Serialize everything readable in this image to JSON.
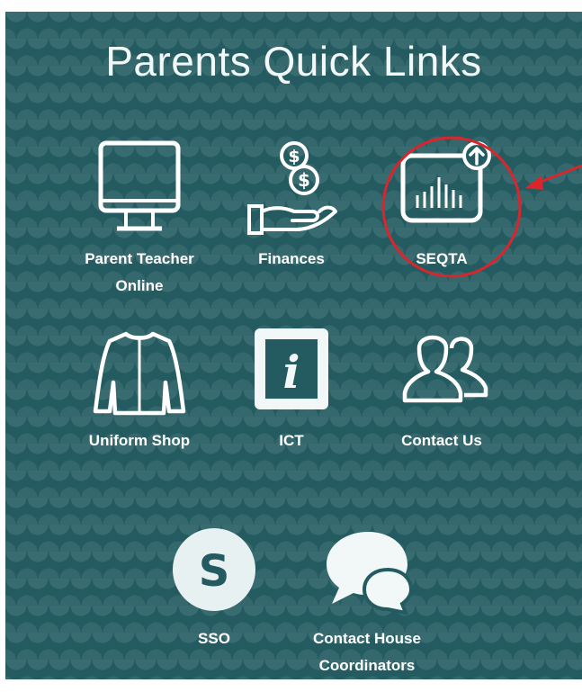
{
  "page": {
    "title": "Parents Quick Links"
  },
  "links": {
    "parent_teacher": {
      "label": "Parent Teacher Online",
      "icon": "monitor-icon"
    },
    "finances": {
      "label": "Finances",
      "icon": "money-hand-icon"
    },
    "seqta": {
      "label": "SEQTA",
      "icon": "chart-upload-icon"
    },
    "uniform": {
      "label": "Uniform Shop",
      "icon": "jacket-icon"
    },
    "ict": {
      "label": "ICT",
      "icon": "info-icon"
    },
    "contact_us": {
      "label": "Contact Us",
      "icon": "users-icon"
    },
    "sso": {
      "label": "SSO",
      "icon": "s-circle-icon",
      "glyph": "S"
    },
    "house": {
      "label": "Contact House Coordinators",
      "icon": "chat-bubbles-icon"
    }
  },
  "colors": {
    "background": "#235b61",
    "icon": "#ffffff",
    "annotation": "#d9262c"
  }
}
